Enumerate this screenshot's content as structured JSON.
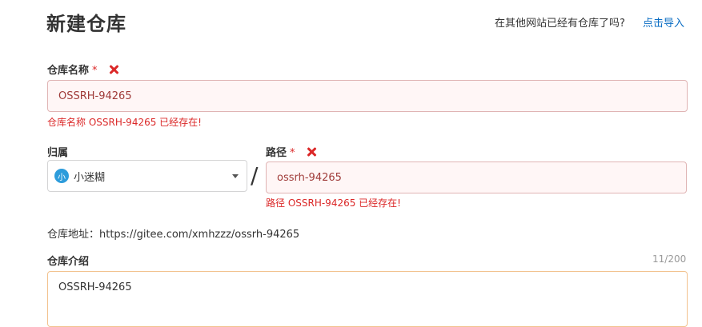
{
  "page": {
    "title": "新建仓库"
  },
  "import": {
    "question": "在其他网站已经有仓库了吗?",
    "link": "点击导入"
  },
  "repo_name": {
    "label": "仓库名称",
    "required_mark": "*",
    "value": "OSSRH-94265",
    "error": "仓库名称 OSSRH-94265 已经存在!"
  },
  "owner": {
    "label": "归属",
    "avatar_text": "小",
    "selected": "小迷糊"
  },
  "separator": "/",
  "path": {
    "label": "路径",
    "required_mark": "*",
    "value": "ossrh-94265",
    "error": "路径 OSSRH-94265 已经存在!"
  },
  "address": {
    "text": "仓库地址：https://gitee.com/xmhzzz/ossrh-94265"
  },
  "description": {
    "label": "仓库介绍",
    "counter": "11/200",
    "value": "OSSRH-94265"
  },
  "colors": {
    "error": "#db2828",
    "error_bg": "#fff6f6",
    "link": "#096cc3",
    "focus_border": "#f2c28e"
  },
  "icons": {
    "error_mark": "close-icon",
    "dropdown": "chevron-down-icon"
  }
}
